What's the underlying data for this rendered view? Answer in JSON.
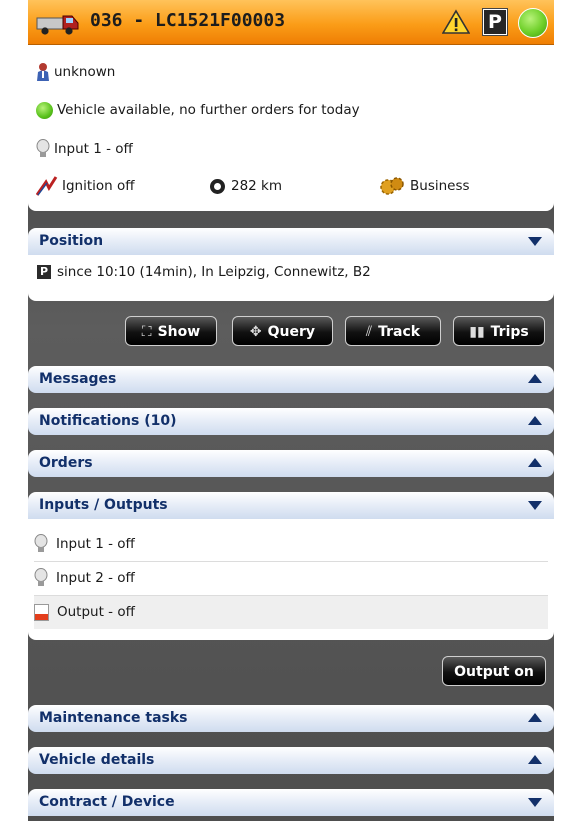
{
  "header": {
    "title": "036 - LC1521F00003",
    "icons": [
      "truck-icon",
      "warning-icon",
      "parking-icon",
      "status-green-icon"
    ],
    "park_letter": "P",
    "accent_color": "#fb9d18"
  },
  "info": {
    "driver": "unknown",
    "availability": "Vehicle available, no further orders for today",
    "input": "Input 1 - off",
    "ignition": "Ignition off",
    "mileage": "282 km",
    "trip_type": "Business"
  },
  "position": {
    "label": "Position",
    "badge": "P",
    "text": "since 10:10 (14min), In Leipzig, Connewitz, B2"
  },
  "actions": {
    "show": "Show",
    "query": "Query",
    "track": "Track",
    "trips": "Trips"
  },
  "sections": {
    "messages": "Messages",
    "notifications": "Notifications (10)",
    "orders": "Orders",
    "io": "Inputs / Outputs",
    "maintenance": "Maintenance tasks",
    "vehicle_details": "Vehicle details",
    "contract": "Contract / Device"
  },
  "io_items": [
    "Input 1 - off",
    "Input 2 - off",
    "Output - off"
  ],
  "output_button": "Output on"
}
